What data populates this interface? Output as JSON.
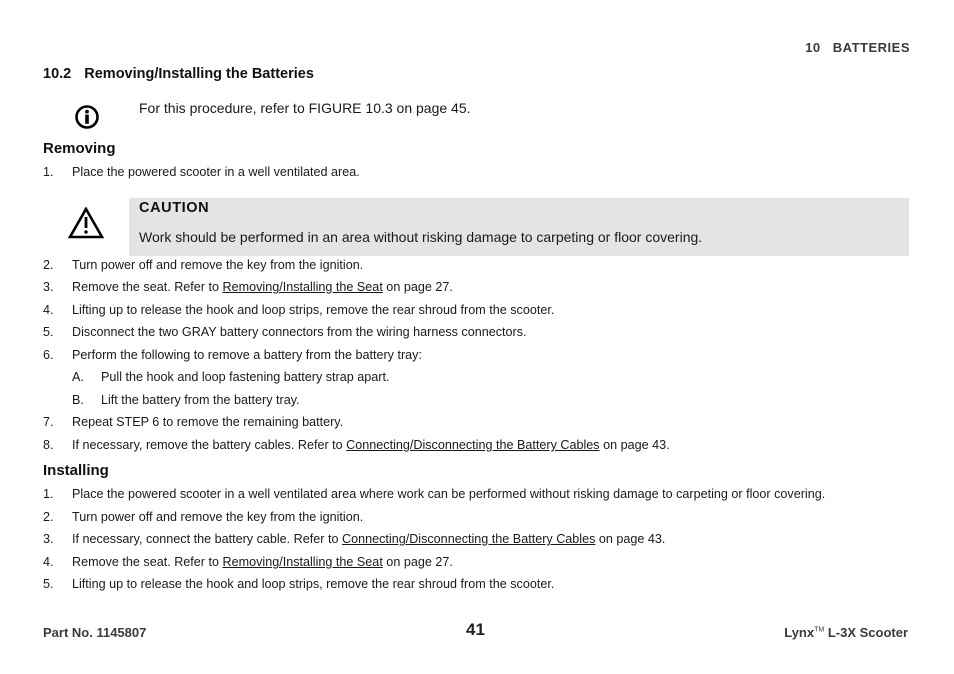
{
  "header": {
    "chapter_number": "10",
    "chapter_title": "BATTERIES"
  },
  "section": {
    "number": "10.2",
    "title": "Removing/Installing the Batteries"
  },
  "note": {
    "icon": "info-icon",
    "text": "For this procedure, refer to FIGURE 10.3 on page 45."
  },
  "removing": {
    "heading": "Removing",
    "step1": {
      "n": "1.",
      "text": "Place the powered scooter in a well ventilated area."
    },
    "caution": {
      "icon": "warning-triangle-icon",
      "title": "CAUTION",
      "text": "Work should be performed in an area without risking damage to carpeting or floor covering."
    },
    "steps": [
      {
        "n": "2.",
        "text": "Turn power off and remove the key from the ignition."
      },
      {
        "n": "3.",
        "pre": "Remove the seat. Refer to ",
        "link": "Removing/Installing the Seat",
        "post": " on page 27."
      },
      {
        "n": "4.",
        "text": "Lifting up to release the hook and loop strips, remove the rear shroud from the scooter."
      },
      {
        "n": "5.",
        "text": "Disconnect the two GRAY battery connectors from the wiring harness connectors."
      },
      {
        "n": "6.",
        "text": "Perform the following to remove a battery from the battery tray:"
      },
      {
        "n": "A.",
        "text": "Pull the hook and loop fastening battery strap apart."
      },
      {
        "n": "B.",
        "text": "Lift the battery from the battery tray."
      },
      {
        "n": "7.",
        "text": "Repeat STEP 6 to remove the remaining battery."
      },
      {
        "n": "8.",
        "pre": "If necessary, remove the battery cables. Refer to ",
        "link": "Connecting/Disconnecting the Battery Cables",
        "post": " on page 43."
      }
    ]
  },
  "installing": {
    "heading": "Installing",
    "steps": [
      {
        "n": "1.",
        "text": "Place the powered scooter in a well ventilated area where work can be performed without risking damage to carpeting or floor covering."
      },
      {
        "n": "2.",
        "text": "Turn power off and remove the key from the ignition."
      },
      {
        "n": "3.",
        "pre": "If necessary, connect the battery cable. Refer to ",
        "link": "Connecting/Disconnecting the Battery Cables",
        "post": " on page 43."
      },
      {
        "n": "4.",
        "pre": "Remove the seat. Refer to ",
        "link": "Removing/Installing the Seat",
        "post": " on page 27."
      },
      {
        "n": "5.",
        "text": "Lifting up to release the hook and loop strips, remove the rear shroud from the scooter."
      }
    ]
  },
  "footer": {
    "part_no": "Part No. 1145807",
    "page_number": "41",
    "product": "Lynx",
    "trademark": "TM",
    "model": " L-3X Scooter"
  },
  "colors": {
    "caution_bg": "#e4e4e4",
    "header_text": "#3a3a3a"
  }
}
